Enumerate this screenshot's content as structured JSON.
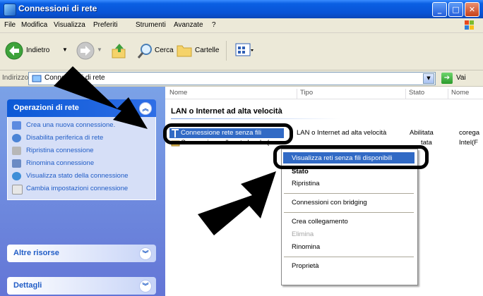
{
  "window": {
    "title": "Connessioni di rete"
  },
  "menu": [
    "File",
    "Modifica",
    "Visualizza",
    "Preferiti",
    "Strumenti",
    "Avanzate",
    "?"
  ],
  "toolbar": {
    "back_label": "Indietro",
    "search_label": "Cerca",
    "folders_label": "Cartelle"
  },
  "address": {
    "label": "Indirizzo",
    "value": "Connessioni di rete",
    "go_label": "Vai"
  },
  "left_pane": {
    "network_tasks": {
      "title": "Operazioni di rete",
      "items": [
        "Crea una nuova connessione.",
        "Disabilita periferica di rete",
        "Ripristina connessione",
        "Rinomina connessione",
        "Visualizza stato della connessione",
        "Cambia impostazioni connessione"
      ]
    },
    "other_places": {
      "title": "Altre risorse"
    },
    "details": {
      "title": "Dettagli"
    }
  },
  "columns": [
    "Nome",
    "Tipo",
    "Stato",
    "Nome"
  ],
  "group": {
    "title": "LAN o Internet ad alta velocità"
  },
  "rows": [
    {
      "name": "Connessione rete senza fili",
      "type": "LAN o Internet ad alta velocità",
      "status": "Abilitata",
      "device": "corega"
    },
    {
      "name": "Connessione alla rete locale (",
      "type": "",
      "status": "tata",
      "device": "Intel(F"
    }
  ],
  "context_menu": [
    "Visualizza reti senza fili disponibili",
    "Stato",
    "Ripristina",
    "Connessioni con bridging",
    "Crea collegamento",
    "Elimina",
    "Rinomina",
    "Proprietà"
  ],
  "colors": {
    "selection": "#316ac5",
    "title_blue": "#0854d6",
    "task_link": "#215dc6",
    "pane_bg": "#6f8ee0"
  }
}
